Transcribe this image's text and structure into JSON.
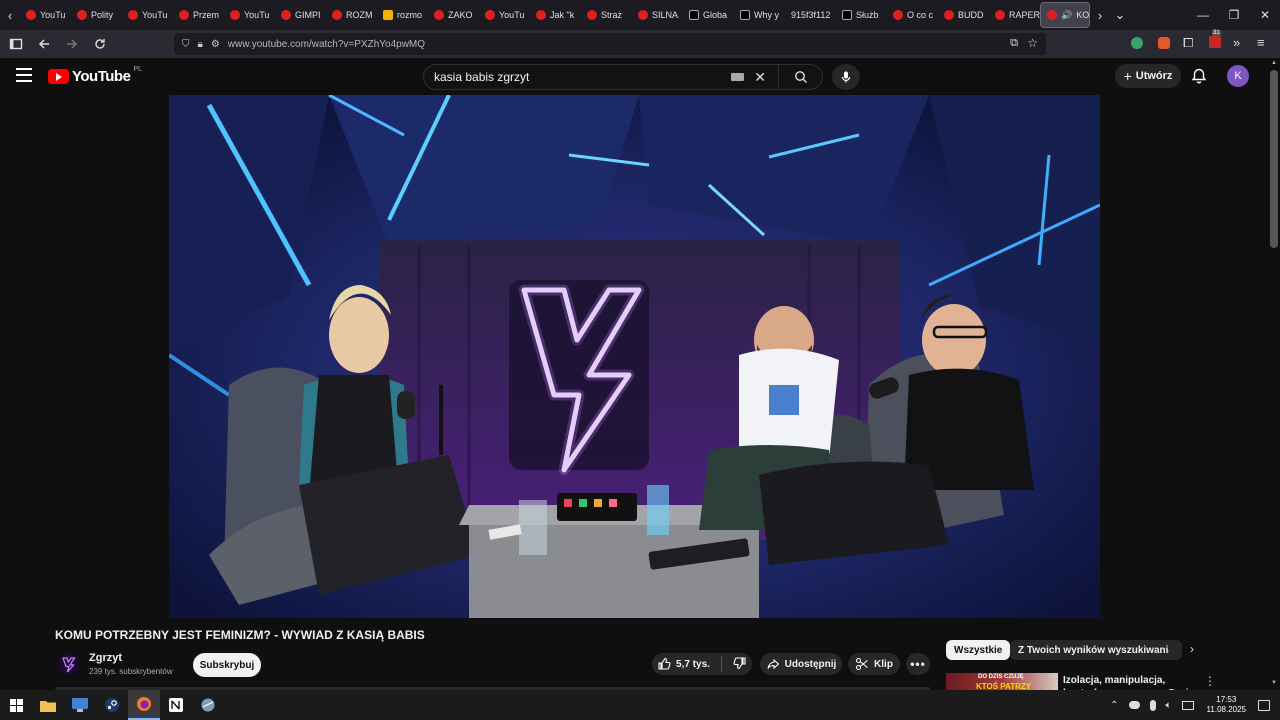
{
  "browser": {
    "tabs": [
      {
        "label": "YouTu",
        "icon": "youtube-icon"
      },
      {
        "label": "Polity",
        "icon": "youtube-icon"
      },
      {
        "label": "YouTu",
        "icon": "youtube-icon"
      },
      {
        "label": "Przem",
        "icon": "youtube-icon"
      },
      {
        "label": "YouTu",
        "icon": "youtube-icon"
      },
      {
        "label": "GIMPI",
        "icon": "youtube-icon"
      },
      {
        "label": "ROZM",
        "icon": "youtube-icon"
      },
      {
        "label": "rozmo",
        "icon": "jp-icon"
      },
      {
        "label": "ZAKO",
        "icon": "youtube-icon"
      },
      {
        "label": "YouTu",
        "icon": "youtube-icon"
      },
      {
        "label": "Jak \"k",
        "icon": "youtube-icon"
      },
      {
        "label": "Straż",
        "icon": "youtube-icon"
      },
      {
        "label": "SILNA",
        "icon": "youtube-icon"
      },
      {
        "label": "Globa",
        "icon": "x-icon"
      },
      {
        "label": "Why y",
        "icon": "x-icon"
      },
      {
        "label": "915f3f112",
        "icon": ""
      },
      {
        "label": "Służb",
        "icon": "x-icon"
      },
      {
        "label": "O co c",
        "icon": "youtube-icon"
      },
      {
        "label": "BUDD",
        "icon": "youtube-icon"
      },
      {
        "label": "RAPER",
        "icon": "youtube-icon"
      }
    ],
    "active_tab": {
      "label": "KOI"
    },
    "url": "www.youtube.com/watch?v=PXZhYo4pwMQ",
    "extension_badge": "31"
  },
  "youtube": {
    "logo_text": "YouTube",
    "region": "PL",
    "search_query": "kasia babis zgrzyt",
    "create_label": "Utwórz",
    "avatar_letter": "K"
  },
  "video": {
    "title": "KOMU POTRZEBNY JEST FEMINIZM? - WYWIAD Z KASIĄ BABIS",
    "channel_name": "Zgrzyt",
    "subscribers": "239 tys. subskrybentów",
    "subscribe_label": "Subskrybuj",
    "likes": "5,7 tys.",
    "share_label": "Udostępnij",
    "clip_label": "Klip"
  },
  "chips": [
    "Wszystkie",
    "Z Twoich wyników wyszukiwania"
  ],
  "recommendation": {
    "title": "Izolacja, manipulacja, kontrola – rozmowa z Oazią z Gaba",
    "thumb_text_top": "DO DZIŚ CZUJĘ",
    "thumb_text_big": "KTOŚ PATRZY"
  },
  "taskbar": {
    "time": "17:53",
    "date": "11.08.2025"
  }
}
